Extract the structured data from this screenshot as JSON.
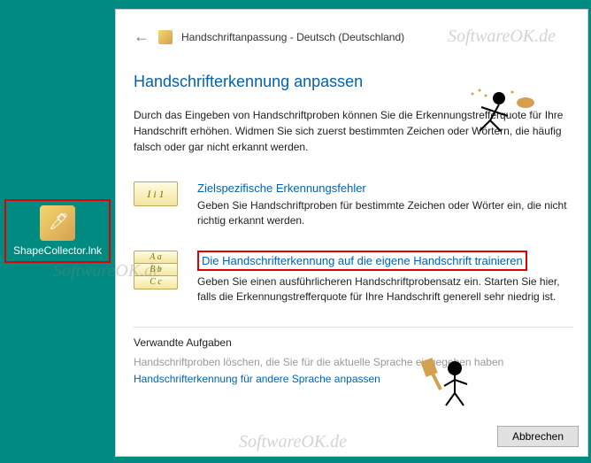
{
  "desktop": {
    "icon_label": "ShapeCollector.lnk"
  },
  "breadcrumb": {
    "title": "Handschriftanpassung - Deutsch (Deutschland)"
  },
  "page": {
    "title": "Handschrifterkennung anpassen",
    "intro": "Durch das Eingeben von Handschriftproben können Sie die Erkennungstrefferquote für Ihre Handschrift erhöhen. Widmen Sie sich zuerst bestimmten Zeichen oder Wörtern, die häufig falsch oder gar nicht erkannt werden."
  },
  "options": [
    {
      "icon_text": "I i 1",
      "title": "Zielspezifische Erkennungsfehler",
      "desc": "Geben Sie Handschriftproben für bestimmte Zeichen oder Wörter ein, die nicht richtig erkannt werden."
    },
    {
      "icon_lines": [
        "A a",
        "B b",
        "C c"
      ],
      "title": "Die Handschrifterkennung auf die eigene Handschrift trainieren",
      "desc": "Geben Sie einen ausführlicheren Handschriftprobensatz ein. Starten Sie hier, falls die Erkennungstrefferquote für Ihre Handschrift generell sehr niedrig ist."
    }
  ],
  "related": {
    "title": "Verwandte Aufgaben",
    "link1": "Handschriftproben löschen, die Sie für die aktuelle Sprache eingegeben haben",
    "link2": "Handschrifterkennung für andere Sprache anpassen"
  },
  "buttons": {
    "cancel": "Abbrechen"
  },
  "watermark": "SoftwareOK.de"
}
